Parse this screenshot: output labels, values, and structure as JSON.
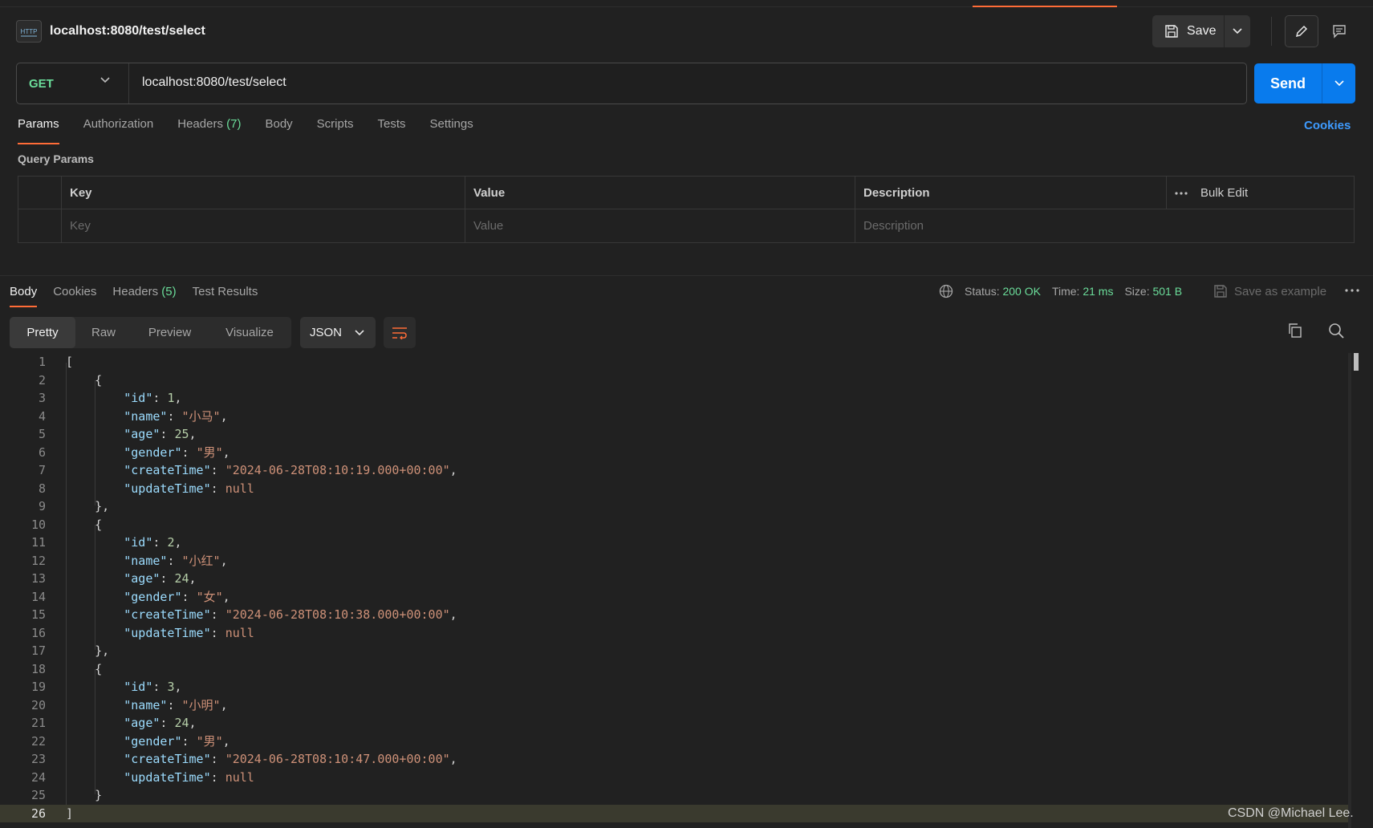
{
  "request": {
    "title": "localhost:8080/test/select",
    "method": "GET",
    "url": "localhost:8080/test/select",
    "save_label": "Save",
    "send_label": "Send",
    "http_badge": "HTTP"
  },
  "request_tabs": [
    {
      "label": "Params",
      "active": true
    },
    {
      "label": "Authorization"
    },
    {
      "label": "Headers",
      "count": "(7)"
    },
    {
      "label": "Body"
    },
    {
      "label": "Scripts"
    },
    {
      "label": "Tests"
    },
    {
      "label": "Settings"
    }
  ],
  "cookies_link": "Cookies",
  "query_params": {
    "label": "Query Params",
    "columns": [
      "Key",
      "Value",
      "Description"
    ],
    "placeholders": [
      "Key",
      "Value",
      "Description"
    ],
    "bulk_edit": "Bulk Edit"
  },
  "response_tabs": [
    {
      "label": "Body",
      "active": true
    },
    {
      "label": "Cookies"
    },
    {
      "label": "Headers",
      "count": "(5)"
    },
    {
      "label": "Test Results"
    }
  ],
  "response_status": {
    "status_label": "Status:",
    "status_value": "200 OK",
    "time_label": "Time:",
    "time_value": "21 ms",
    "size_label": "Size:",
    "size_value": "501 B",
    "save_example": "Save as example"
  },
  "view_modes": [
    "Pretty",
    "Raw",
    "Preview",
    "Visualize"
  ],
  "format": "JSON",
  "colors": {
    "accent": "#ff6c37",
    "send": "#097bed",
    "green": "#6bdd9a",
    "link": "#3e9bff"
  },
  "records": [
    {
      "id": "1",
      "name": "\"小马\"",
      "age": "25",
      "gender": "\"男\"",
      "createTime": "\"2024-06-28T08:10:19.000+00:00\"",
      "updateTime": "null"
    },
    {
      "id": "2",
      "name": "\"小红\"",
      "age": "24",
      "gender": "\"女\"",
      "createTime": "\"2024-06-28T08:10:38.000+00:00\"",
      "updateTime": "null"
    },
    {
      "id": "3",
      "name": "\"小明\"",
      "age": "24",
      "gender": "\"男\"",
      "createTime": "\"2024-06-28T08:10:47.000+00:00\"",
      "updateTime": "null"
    }
  ],
  "line_numbers": [
    "1",
    "2",
    "3",
    "4",
    "5",
    "6",
    "7",
    "8",
    "9",
    "10",
    "11",
    "12",
    "13",
    "14",
    "15",
    "16",
    "17",
    "18",
    "19",
    "20",
    "21",
    "22",
    "23",
    "24",
    "25",
    "26"
  ],
  "json_keys": {
    "id": "\"id\"",
    "name": "\"name\"",
    "age": "\"age\"",
    "gender": "\"gender\"",
    "createTime": "\"createTime\"",
    "updateTime": "\"updateTime\""
  },
  "watermark": "CSDN @Michael Lee."
}
